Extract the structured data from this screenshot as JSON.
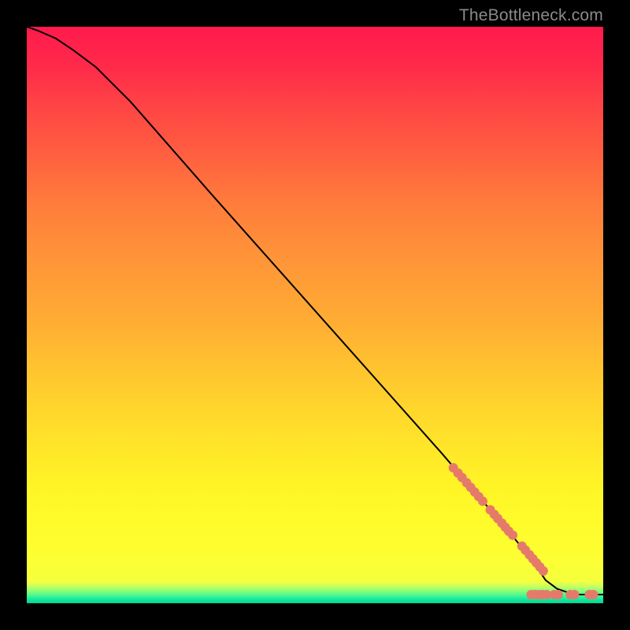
{
  "attribution": "TheBottleneck.com",
  "chart_data": {
    "type": "line",
    "title": "",
    "xlabel": "",
    "ylabel": "",
    "xlim": [
      0,
      100
    ],
    "ylim": [
      0,
      100
    ],
    "grid": false,
    "legend": false,
    "background": {
      "type": "vertical-gradient",
      "stops": [
        {
          "pos": 0,
          "color": "#ff1a4d"
        },
        {
          "pos": 50,
          "color": "#ffaa34"
        },
        {
          "pos": 85,
          "color": "#fffb2a"
        },
        {
          "pos": 97,
          "color": "#e8ff50"
        },
        {
          "pos": 100,
          "color": "#00d68c"
        }
      ]
    },
    "series": [
      {
        "name": "curve",
        "color": "#000000",
        "type": "line",
        "x": [
          0,
          2,
          5,
          8,
          12,
          18,
          25,
          32,
          40,
          48,
          56,
          64,
          72,
          78,
          84,
          88,
          90,
          92,
          95,
          100
        ],
        "y": [
          100,
          99.3,
          98,
          96,
          93,
          87,
          79,
          71,
          62,
          53,
          44,
          35,
          26,
          19,
          12,
          7,
          4,
          2.5,
          1.5,
          1.5
        ]
      },
      {
        "name": "highlight-points",
        "color": "#e67a6a",
        "type": "scatter",
        "points": [
          {
            "x": 74.0,
            "y": 23.5
          },
          {
            "x": 74.8,
            "y": 22.6
          },
          {
            "x": 75.5,
            "y": 21.8
          },
          {
            "x": 76.3,
            "y": 20.9
          },
          {
            "x": 77.0,
            "y": 20.1
          },
          {
            "x": 77.7,
            "y": 19.3
          },
          {
            "x": 78.4,
            "y": 18.5
          },
          {
            "x": 79.1,
            "y": 17.7
          },
          {
            "x": 80.4,
            "y": 16.2
          },
          {
            "x": 81.1,
            "y": 15.4
          },
          {
            "x": 81.7,
            "y": 14.7
          },
          {
            "x": 82.4,
            "y": 13.9
          },
          {
            "x": 83.0,
            "y": 13.2
          },
          {
            "x": 83.6,
            "y": 12.5
          },
          {
            "x": 84.3,
            "y": 11.8
          },
          {
            "x": 85.9,
            "y": 9.9
          },
          {
            "x": 86.5,
            "y": 9.2
          },
          {
            "x": 87.2,
            "y": 8.4
          },
          {
            "x": 87.8,
            "y": 7.7
          },
          {
            "x": 88.4,
            "y": 7.0
          },
          {
            "x": 89.0,
            "y": 6.3
          },
          {
            "x": 89.6,
            "y": 5.6
          },
          {
            "x": 87.5,
            "y": 1.5
          },
          {
            "x": 88.2,
            "y": 1.5
          },
          {
            "x": 88.9,
            "y": 1.5
          },
          {
            "x": 89.5,
            "y": 1.5
          },
          {
            "x": 90.2,
            "y": 1.5
          },
          {
            "x": 91.5,
            "y": 1.5
          },
          {
            "x": 92.2,
            "y": 1.5
          },
          {
            "x": 94.3,
            "y": 1.5
          },
          {
            "x": 95.0,
            "y": 1.5
          },
          {
            "x": 97.6,
            "y": 1.5
          },
          {
            "x": 98.3,
            "y": 1.5
          }
        ]
      }
    ]
  }
}
